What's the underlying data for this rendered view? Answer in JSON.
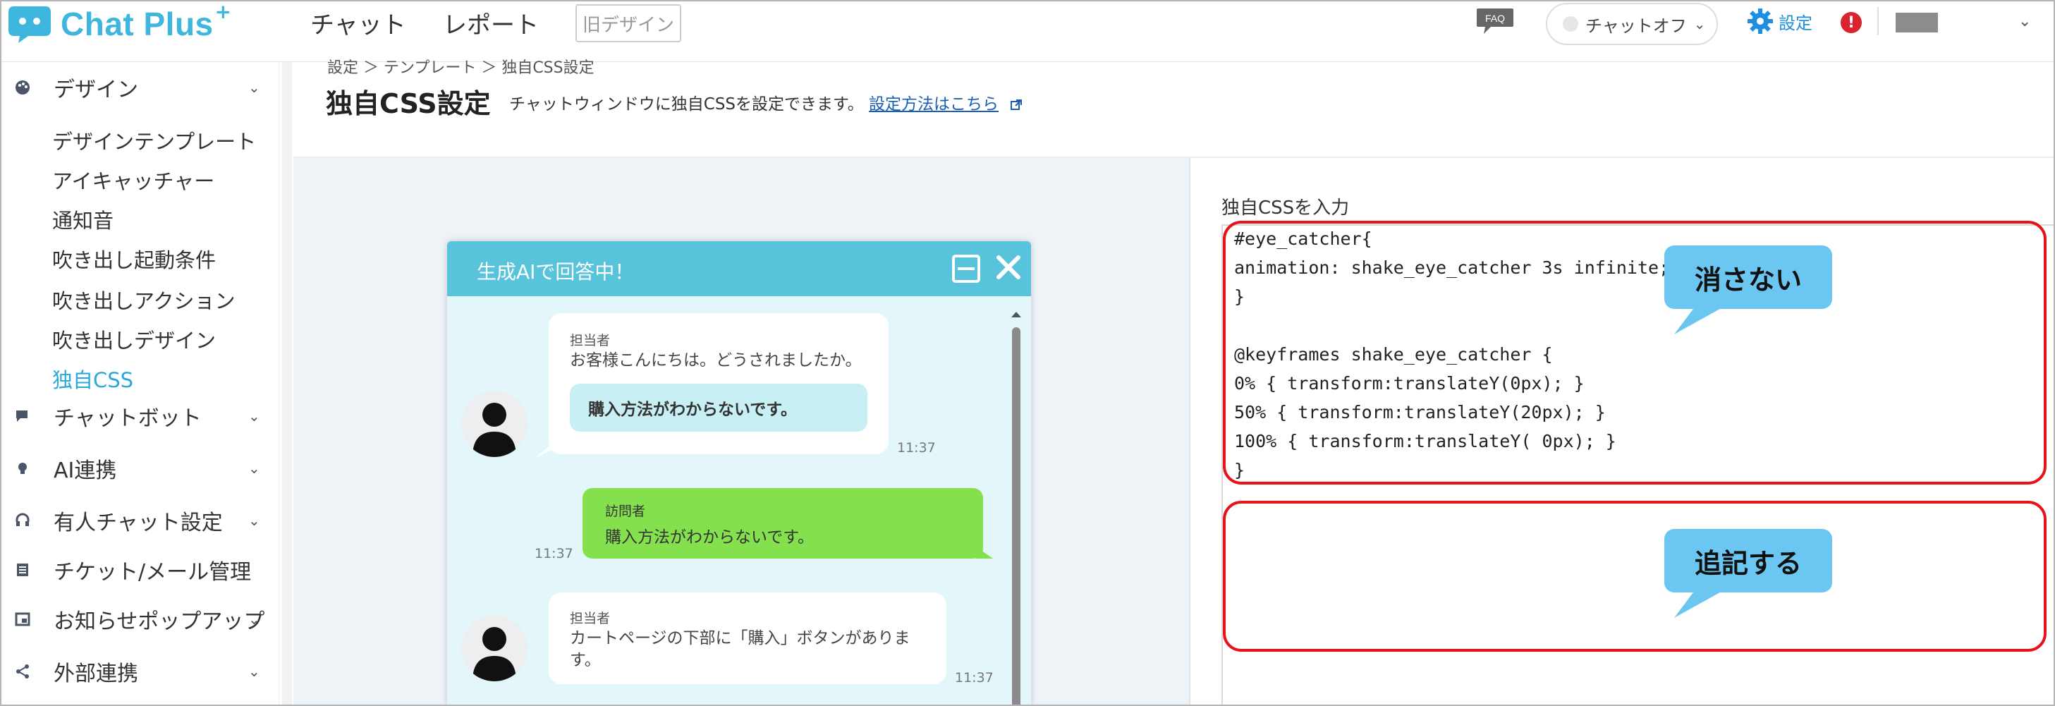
{
  "header": {
    "logo_text": "Chat Plus",
    "logo_plus": "+",
    "nav": [
      "チャット",
      "レポート"
    ],
    "old_design": "旧デザイン",
    "faq": "FAQ",
    "status_label": "チャットオフ",
    "settings_label": "設定",
    "alert": "!"
  },
  "sidebar": {
    "groups": [
      {
        "label": "デザイン",
        "icon": "palette-icon"
      },
      {
        "label": "チャットボット",
        "icon": "chat-icon"
      },
      {
        "label": "AI連携",
        "icon": "bulb-icon"
      },
      {
        "label": "有人チャット設定",
        "icon": "headset-icon"
      },
      {
        "label": "チケット/メール管理",
        "icon": "ticket-icon"
      },
      {
        "label": "お知らせポップアップ",
        "icon": "popup-icon"
      },
      {
        "label": "外部連携",
        "icon": "share-icon"
      }
    ],
    "design_items": [
      "デザインテンプレート",
      "アイキャッチャー",
      "通知音",
      "吹き出し起動条件",
      "吹き出しアクション",
      "吹き出しデザイン",
      "独自CSS"
    ],
    "active_item": "独自CSS"
  },
  "breadcrumb": "設定 ＞ テンプレート ＞ 独自CSS設定",
  "page": {
    "title": "独自CSS設定",
    "subtitle": "チャットウィンドウに独自CSSを設定できます。",
    "help_link": "設定方法はこちら"
  },
  "chat_preview": {
    "header_title": "生成AIで回答中！",
    "messages": [
      {
        "who": "担当者",
        "text": "お客様こんにちは。どうされましたか。",
        "quick_reply": "購入方法がわからないです。",
        "time": "11:37"
      },
      {
        "who": "訪問者",
        "text": "購入方法がわからないです。",
        "time": "11:37"
      },
      {
        "who": "担当者",
        "text_lines": [
          "カートページの下部に「購入」ボタンがありま",
          "す。"
        ],
        "time": "11:37"
      }
    ]
  },
  "css_editor": {
    "label": "独自CSSを入力",
    "lines": [
      "#eye_catcher{",
      "animation: shake_eye_catcher 3s infinite;",
      "}",
      "",
      "@keyframes shake_eye_catcher {",
      "0% { transform:translateY(0px); }",
      "50% { transform:translateY(20px); }",
      "100% { transform:translateY( 0px); }",
      "}"
    ]
  },
  "annotations": {
    "keep": "消さない",
    "append": "追記する"
  },
  "colors": {
    "brand": "#3fb6dd",
    "chat_header": "#58c4dc",
    "visitor_bubble": "#84e04d",
    "highlight_red": "#e8121a",
    "callout": "#6bc7f2"
  }
}
